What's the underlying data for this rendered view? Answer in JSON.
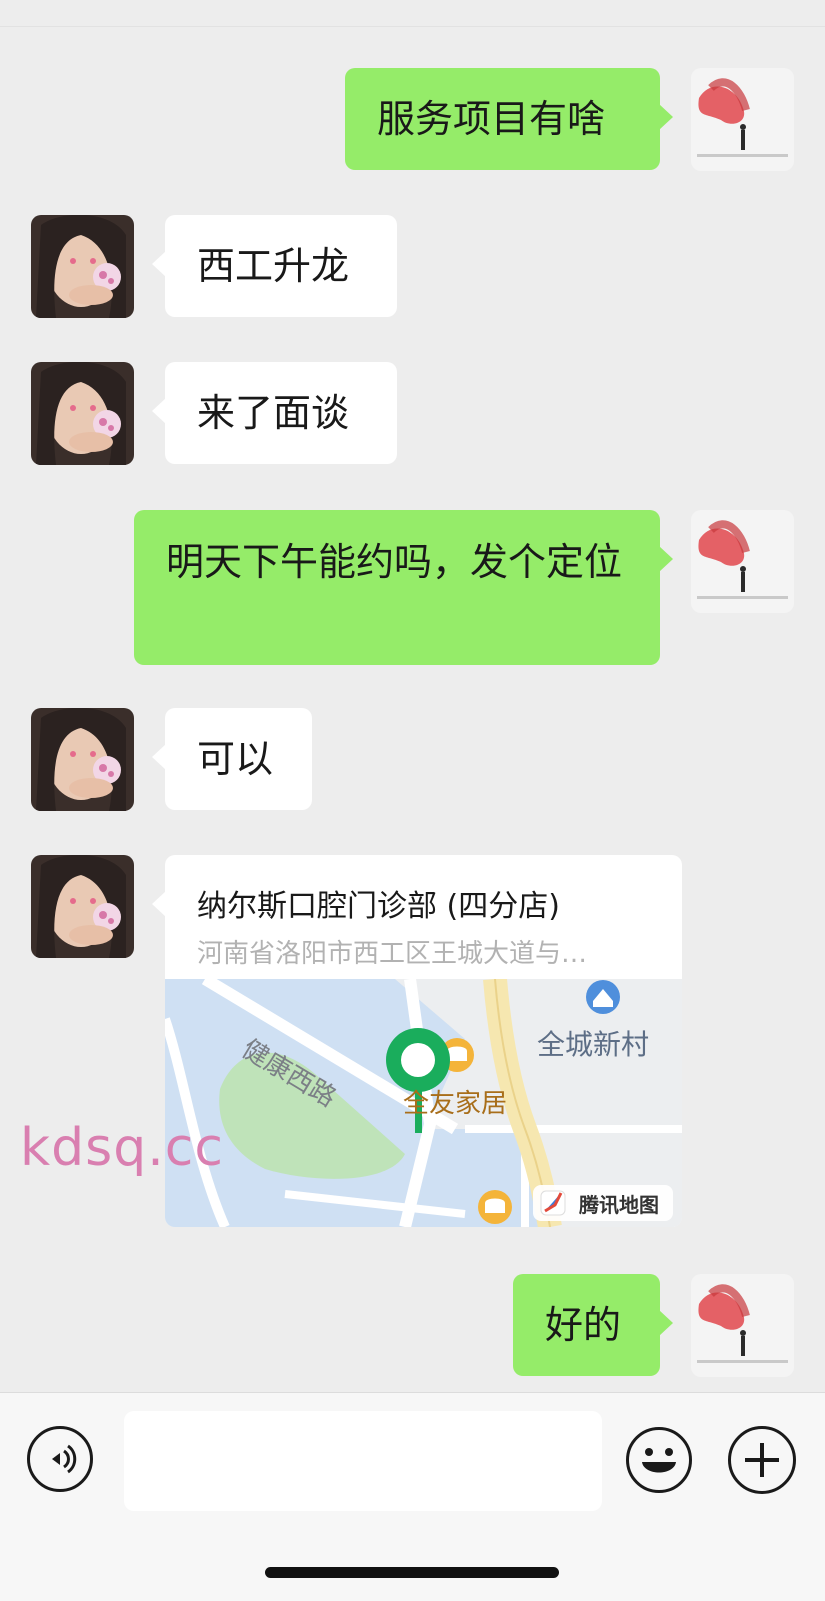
{
  "messages": [
    {
      "side": "out",
      "text": "服务项目有啥"
    },
    {
      "side": "in",
      "text": "西工升龙"
    },
    {
      "side": "in",
      "text": "来了面谈"
    },
    {
      "side": "out",
      "text": "明天下午能约吗，发个定位"
    },
    {
      "side": "in",
      "text": "可以"
    },
    {
      "side": "out",
      "text": "好的"
    }
  ],
  "location": {
    "title": "纳尔斯口腔门诊部 (四分店)",
    "address": "河南省洛阳市西工区王城大道与…",
    "map": {
      "road_label": "健康西路",
      "poi_1": "全城新村",
      "poi_2": "全友家居",
      "provider": "腾讯地图"
    }
  },
  "watermark": "kdsq.cc",
  "colors": {
    "outgoing_bubble": "#95ec69",
    "incoming_bubble": "#ffffff",
    "background": "#ededed",
    "pin": "#1aad5c"
  },
  "icons": {
    "voice": "voice-icon",
    "emoji": "emoji-icon",
    "plus": "plus-icon"
  }
}
